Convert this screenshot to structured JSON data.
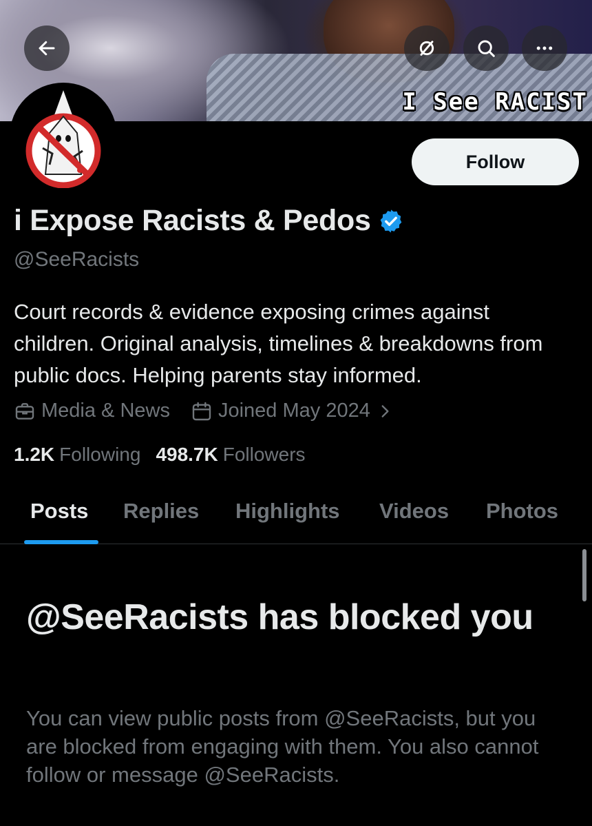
{
  "banner": {
    "caption": "I See RACIST"
  },
  "toolbar": {
    "back_icon": "arrow-left-icon",
    "grok_icon": "slashed-circle-icon",
    "search_icon": "search-icon",
    "more_icon": "more-horizontal-icon"
  },
  "profile": {
    "display_name": "i Expose Racists & Pedos",
    "handle": "@SeeRacists",
    "verified": true,
    "follow_label": "Follow",
    "bio": "Court records & evidence exposing crimes against children. Original analysis, timelines & breakdowns from public docs. Helping parents stay informed.",
    "category": "Media & News",
    "joined": "Joined May 2024",
    "following_count": "1.2K",
    "following_label": "Following",
    "followers_count": "498.7K",
    "followers_label": "Followers"
  },
  "tabs": [
    {
      "label": "Posts",
      "active": true
    },
    {
      "label": "Replies",
      "active": false
    },
    {
      "label": "Highlights",
      "active": false
    },
    {
      "label": "Videos",
      "active": false
    },
    {
      "label": "Photos",
      "active": false
    }
  ],
  "blocked": {
    "title": "@SeeRacists has blocked you",
    "description": "You can view public posts from @SeeRacists, but you are blocked from engaging with them. You also cannot follow or message @SeeRacists."
  },
  "colors": {
    "accent": "#1d9bf0",
    "background": "#000000",
    "text_primary": "#e7e9ea",
    "text_secondary": "#71767b",
    "avatar_ring": "#d22b2b"
  }
}
